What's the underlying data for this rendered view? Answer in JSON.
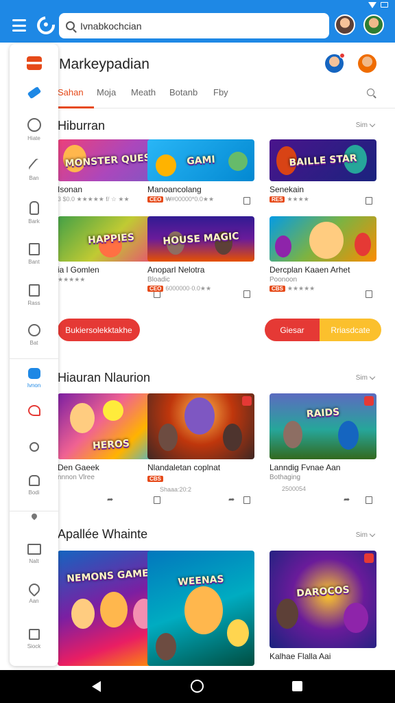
{
  "app_bar": {
    "search_value": "Ivnabkochcian",
    "menu_icon": "menu-icon",
    "logo_icon": "app-logo-icon",
    "accent_color": "#1e88e5"
  },
  "header": {
    "title": "Markeypadian"
  },
  "tabs": [
    {
      "label": "Sahan",
      "active": true
    },
    {
      "label": "Moja",
      "active": false
    },
    {
      "label": "Meath",
      "active": false
    },
    {
      "label": "Botanb",
      "active": false
    },
    {
      "label": "Fby",
      "active": false
    }
  ],
  "rail": [
    {
      "icon": "logo-icon",
      "label": ""
    },
    {
      "icon": "pencil-icon",
      "label": ""
    },
    {
      "icon": "eye-icon",
      "label": "Hiate"
    },
    {
      "icon": "brush-icon",
      "label": "Ban"
    },
    {
      "icon": "hand-icon",
      "label": "Bark"
    },
    {
      "icon": "doc-icon",
      "label": "Bant"
    },
    {
      "icon": "file-icon",
      "label": "Rass"
    },
    {
      "icon": "smile-icon",
      "label": "Bat"
    },
    {
      "icon": "screen-icon",
      "label": "Ivnon"
    },
    {
      "icon": "bird-icon",
      "label": ""
    },
    {
      "icon": "user-icon",
      "label": ""
    },
    {
      "icon": "bag-icon",
      "label": "Bodi"
    },
    {
      "icon": "pin-icon",
      "label": ""
    },
    {
      "icon": "grid-icon",
      "label": "Nalt"
    },
    {
      "icon": "heart-icon",
      "label": "Aan"
    },
    {
      "icon": "box-icon",
      "label": "Siock"
    }
  ],
  "sections": [
    {
      "title": "Hiburran",
      "see_all": "Sim",
      "games": [
        {
          "thumb_text": "MONSTER QUEST",
          "title": "Isonan",
          "meta": "3 $0.0 ★★★★★ f/ ☆ ★★",
          "pill": ""
        },
        {
          "thumb_text": "GAMI",
          "title": "Manoancolang",
          "meta": "₩#00000*0.0★★",
          "pill": "CEO"
        },
        {
          "thumb_text": "BAILLE STAR",
          "title": "Senekain",
          "meta": "★★★★",
          "pill": "RES"
        },
        {
          "thumb_text": "HAPPIES",
          "title": "ia l Gomlen",
          "meta": "★★★★★",
          "pill": ""
        },
        {
          "thumb_text": "HOUSE MAGIC",
          "title": "Anoparl Nelotra",
          "sub": "Bloadic",
          "meta": "6000000·0.0★★",
          "pill": "CEO"
        },
        {
          "thumb_text": "",
          "title": "Dercplan Kaaen Arhet",
          "sub": "Poonoon",
          "meta": "★★★★★",
          "pill": "CBS"
        }
      ]
    },
    {
      "banner_left": "Bukiersolekktakhe",
      "banner_right_a": "Giesar",
      "banner_right_b": "Rriasdcate",
      "banner_left_color": "#e53935",
      "banner_right_color_a": "#e53935",
      "banner_right_color_b": "#fbc02d"
    },
    {
      "title": "Hiauran Nlaurion",
      "see_all": "Sim",
      "games": [
        {
          "thumb_text": "HEROS",
          "title": "Den Gaeek",
          "sub": "nnnon Vlree",
          "meta": "",
          "pill": ""
        },
        {
          "thumb_text": "",
          "title": "Nlandaletan coplnat",
          "sub": "",
          "meta": "Shaaa:20:2",
          "pill": "CBS"
        },
        {
          "thumb_text": "RAIDS",
          "title": "Lanndig Fvnae Aan",
          "sub": "Bothaging",
          "meta": "2500054",
          "pill": ""
        }
      ]
    },
    {
      "title": "Apallée Whainte",
      "see_all": "Sim",
      "games": [
        {
          "thumb_text": "NEMONS GAMES",
          "title": "",
          "sub": "",
          "meta": "",
          "pill": ""
        },
        {
          "thumb_text": "WEENAS",
          "title": "",
          "sub": "",
          "meta": "",
          "pill": ""
        },
        {
          "thumb_text": "DAROCOS",
          "title": "Kalhae Flalla Aai",
          "sub": "",
          "meta": "",
          "pill": ""
        }
      ]
    }
  ]
}
